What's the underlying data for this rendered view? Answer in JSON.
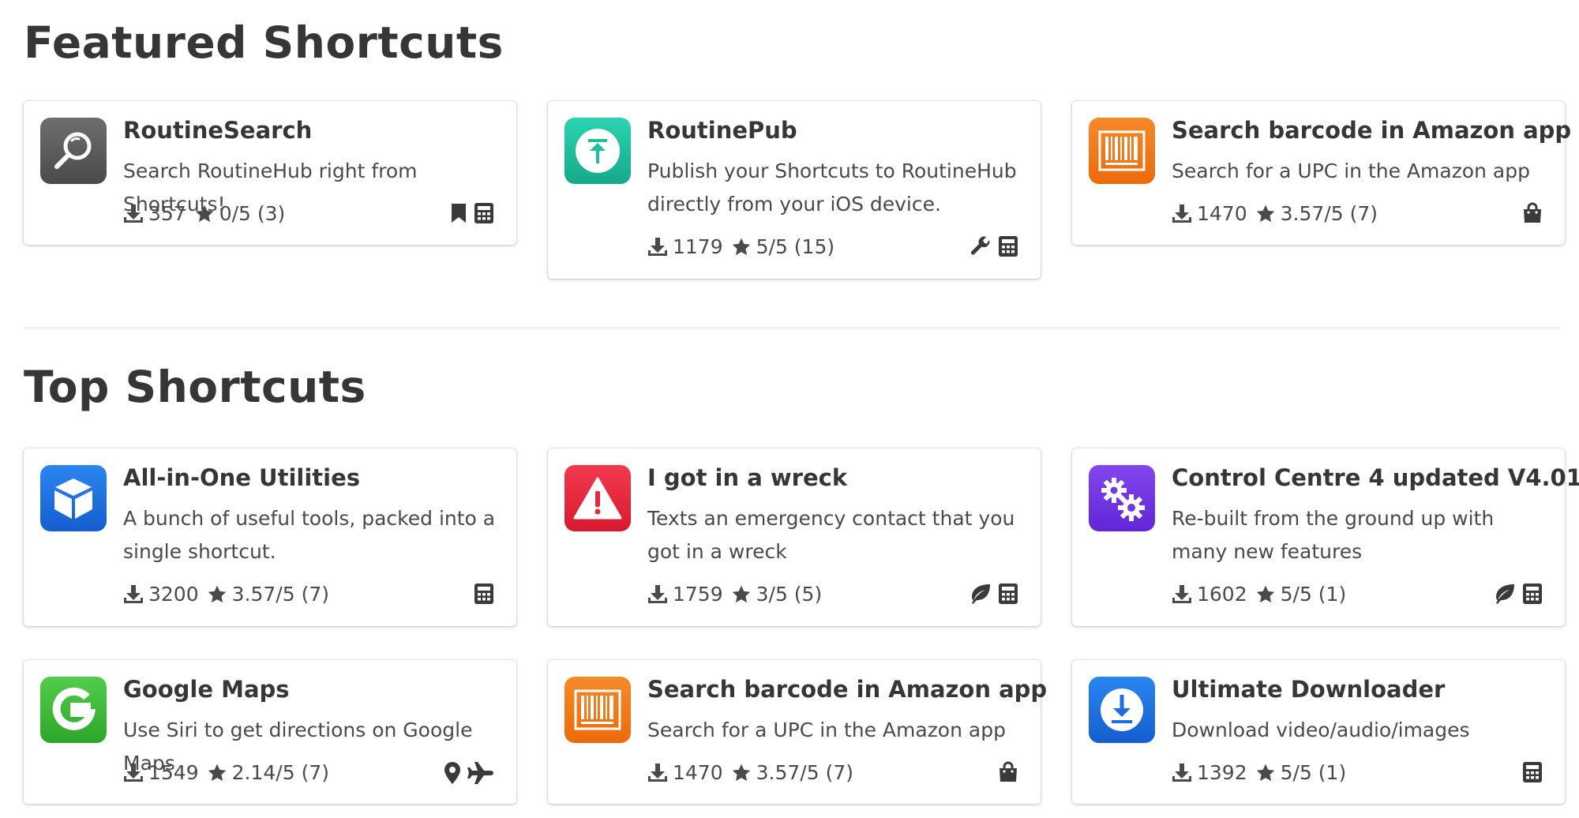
{
  "featured": {
    "title": "Featured Shortcuts",
    "cards": [
      {
        "title": "RoutineSearch",
        "description": "Search RoutineHub right from Shortcuts!",
        "downloads": "357",
        "rating": "0/5 (3)",
        "icon": "magnifier-icon",
        "tags": [
          "bookmark-icon",
          "calculator-icon"
        ]
      },
      {
        "title": "RoutinePub",
        "description": "Publish your Shortcuts to RoutineHub directly from your iOS device.",
        "downloads": "1179",
        "rating": "5/5 (15)",
        "icon": "upload-icon",
        "tags": [
          "wrench-icon",
          "calculator-icon"
        ]
      },
      {
        "title": "Search barcode in Amazon app",
        "description": "Search for a UPC in the Amazon app",
        "downloads": "1470",
        "rating": "3.57/5 (7)",
        "icon": "barcode-icon",
        "tags": [
          "shopping-bag-icon"
        ]
      }
    ]
  },
  "top": {
    "title": "Top Shortcuts",
    "cards": [
      {
        "title": "All-in-One Utilities",
        "description": "A bunch of useful tools, packed into a single shortcut.",
        "downloads": "3200",
        "rating": "3.57/5 (7)",
        "icon": "cube-icon",
        "tags": [
          "calculator-icon"
        ]
      },
      {
        "title": "I got in a wreck",
        "description": "Texts an emergency contact that you got in a wreck",
        "downloads": "1759",
        "rating": "3/5 (5)",
        "icon": "warning-icon",
        "tags": [
          "leaf-icon",
          "calculator-icon"
        ]
      },
      {
        "title": "Control Centre 4 updated V4.01",
        "description": "Re-built from the ground up with many new features",
        "downloads": "1602",
        "rating": "5/5 (1)",
        "icon": "gears-icon",
        "tags": [
          "leaf-icon",
          "calculator-icon"
        ]
      },
      {
        "title": "Google Maps",
        "description": "Use Siri to get directions on Google Maps",
        "downloads": "1549",
        "rating": "2.14/5 (7)",
        "icon": "google-g-icon",
        "tags": [
          "map-marker-icon",
          "plane-icon"
        ]
      },
      {
        "title": "Search barcode in Amazon app",
        "description": "Search for a UPC in the Amazon app",
        "downloads": "1470",
        "rating": "3.57/5 (7)",
        "icon": "barcode-icon",
        "tags": [
          "shopping-bag-icon"
        ]
      },
      {
        "title": "Ultimate Downloader",
        "description": "Download video/audio/images",
        "downloads": "1392",
        "rating": "5/5 (1)",
        "icon": "download-circle-icon",
        "tags": [
          "calculator-icon"
        ]
      }
    ]
  },
  "colors": {
    "text": "#363636",
    "icon_gray": "#5d5d5d",
    "icon_teal": "#1fc2a0",
    "icon_orange": "#f27a1a",
    "icon_blue": "#1d6fe0",
    "icon_red": "#e8283c",
    "icon_purple": "#7338e0",
    "icon_green": "#3dbb3a"
  }
}
